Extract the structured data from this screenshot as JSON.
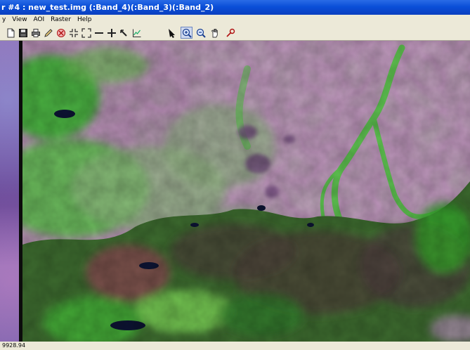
{
  "window": {
    "title": "r #4 : new_test.img (:Band_4)(:Band_3)(:Band_2)"
  },
  "menu": {
    "items": [
      "y",
      "View",
      "AOI",
      "Raster",
      "Help"
    ]
  },
  "toolbar": {
    "tools": [
      {
        "name": "new-icon"
      },
      {
        "name": "save-icon"
      },
      {
        "name": "print-icon"
      },
      {
        "name": "edit-icon"
      },
      {
        "name": "layer-info-icon"
      },
      {
        "name": "fit-icon"
      },
      {
        "name": "expand-icon"
      },
      {
        "name": "minus-icon"
      },
      {
        "name": "crosshair-icon"
      },
      {
        "name": "measure-icon"
      },
      {
        "name": "profile-icon"
      },
      {
        "name": "select-arrow-icon"
      },
      {
        "name": "zoom-in-icon"
      },
      {
        "name": "zoom-out-icon"
      },
      {
        "name": "pan-hand-icon"
      },
      {
        "name": "inquire-icon"
      }
    ]
  },
  "image": {
    "colors": {
      "vegetation": "#47c43a",
      "bare": "#b58bb3",
      "water": "#0d1433",
      "shadow": "#4a3f35"
    }
  },
  "status": {
    "coords": "9928.94"
  }
}
